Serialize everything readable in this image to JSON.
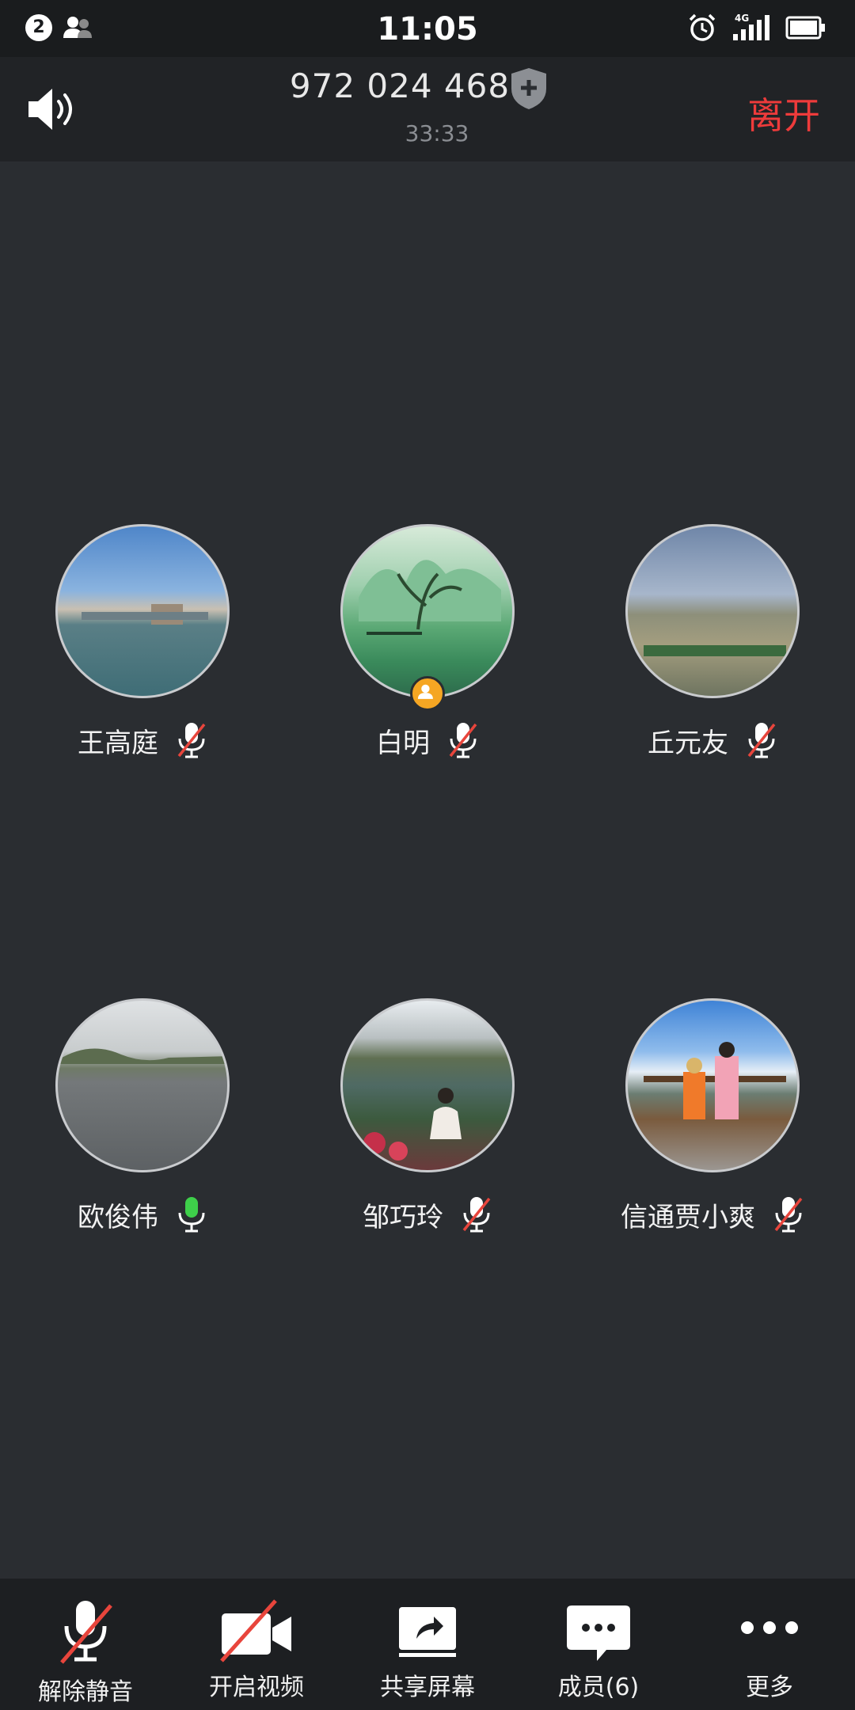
{
  "status_bar": {
    "notification_count": "2",
    "time": "11:05",
    "network": "4G",
    "icons": [
      "people-icon",
      "alarm-icon",
      "signal-icon",
      "battery-icon"
    ]
  },
  "header": {
    "meeting_number": "972 024 468",
    "elapsed_time": "33:33",
    "leave_label": "离开",
    "icons": [
      "speaker-icon",
      "shield-plus-icon"
    ]
  },
  "participants": [
    {
      "name": "王高庭",
      "mic": "muted",
      "host": false
    },
    {
      "name": "白明",
      "mic": "muted",
      "host": true
    },
    {
      "name": "丘元友",
      "mic": "muted",
      "host": false
    },
    {
      "name": "欧俊伟",
      "mic": "active",
      "host": false
    },
    {
      "name": "邹巧玲",
      "mic": "muted",
      "host": false
    },
    {
      "name": "信通贾小爽",
      "mic": "muted",
      "host": false
    }
  ],
  "toolbar": {
    "unmute_label": "解除静音",
    "video_label": "开启视频",
    "share_label": "共享屏幕",
    "members_label": "成员(6)",
    "more_label": "更多"
  },
  "colors": {
    "background": "#2a2d31",
    "leave": "#ee3b3b",
    "mic_active": "#3ecf4a",
    "mute_slash": "#e8453c",
    "host_badge": "#f5a623"
  }
}
